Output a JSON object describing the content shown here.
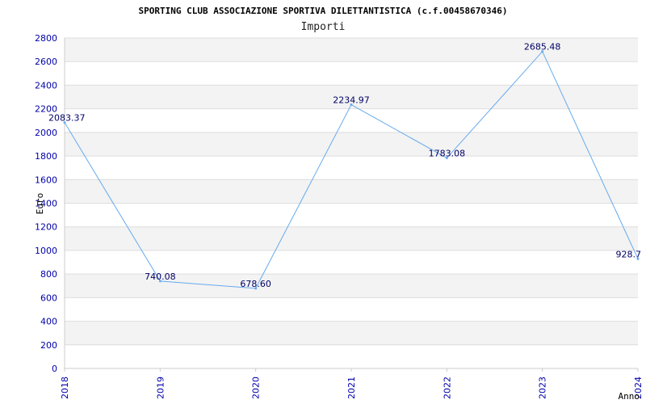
{
  "chart_data": {
    "type": "line",
    "title": "SPORTING CLUB ASSOCIAZIONE SPORTIVA DILETTANTISTICA (c.f.00458670346)",
    "subtitle": "Importi",
    "xlabel": "Anno",
    "ylabel": "Euro",
    "x": [
      "2018",
      "2019",
      "2020",
      "2021",
      "2022",
      "2023",
      "2024"
    ],
    "series": [
      {
        "values": [
          2083.37,
          740.08,
          678.6,
          2234.97,
          1783.08,
          2685.48,
          928.7
        ],
        "labels": [
          "2083.37",
          "740.08",
          "678.60",
          "2234.97",
          "1783.08",
          "2685.48",
          "928.7"
        ]
      }
    ],
    "ylim": [
      0,
      2800
    ],
    "yticks": [
      "0",
      "200",
      "400",
      "600",
      "800",
      "1000",
      "1200",
      "1400",
      "1600",
      "1800",
      "2000",
      "2200",
      "2400",
      "2600",
      "2800"
    ],
    "grid": true,
    "colors": {
      "line": "#66aaee",
      "band": "#f3f3f3",
      "grid": "#dddddd",
      "ticks": "#0000aa",
      "labels": "#000066"
    }
  }
}
